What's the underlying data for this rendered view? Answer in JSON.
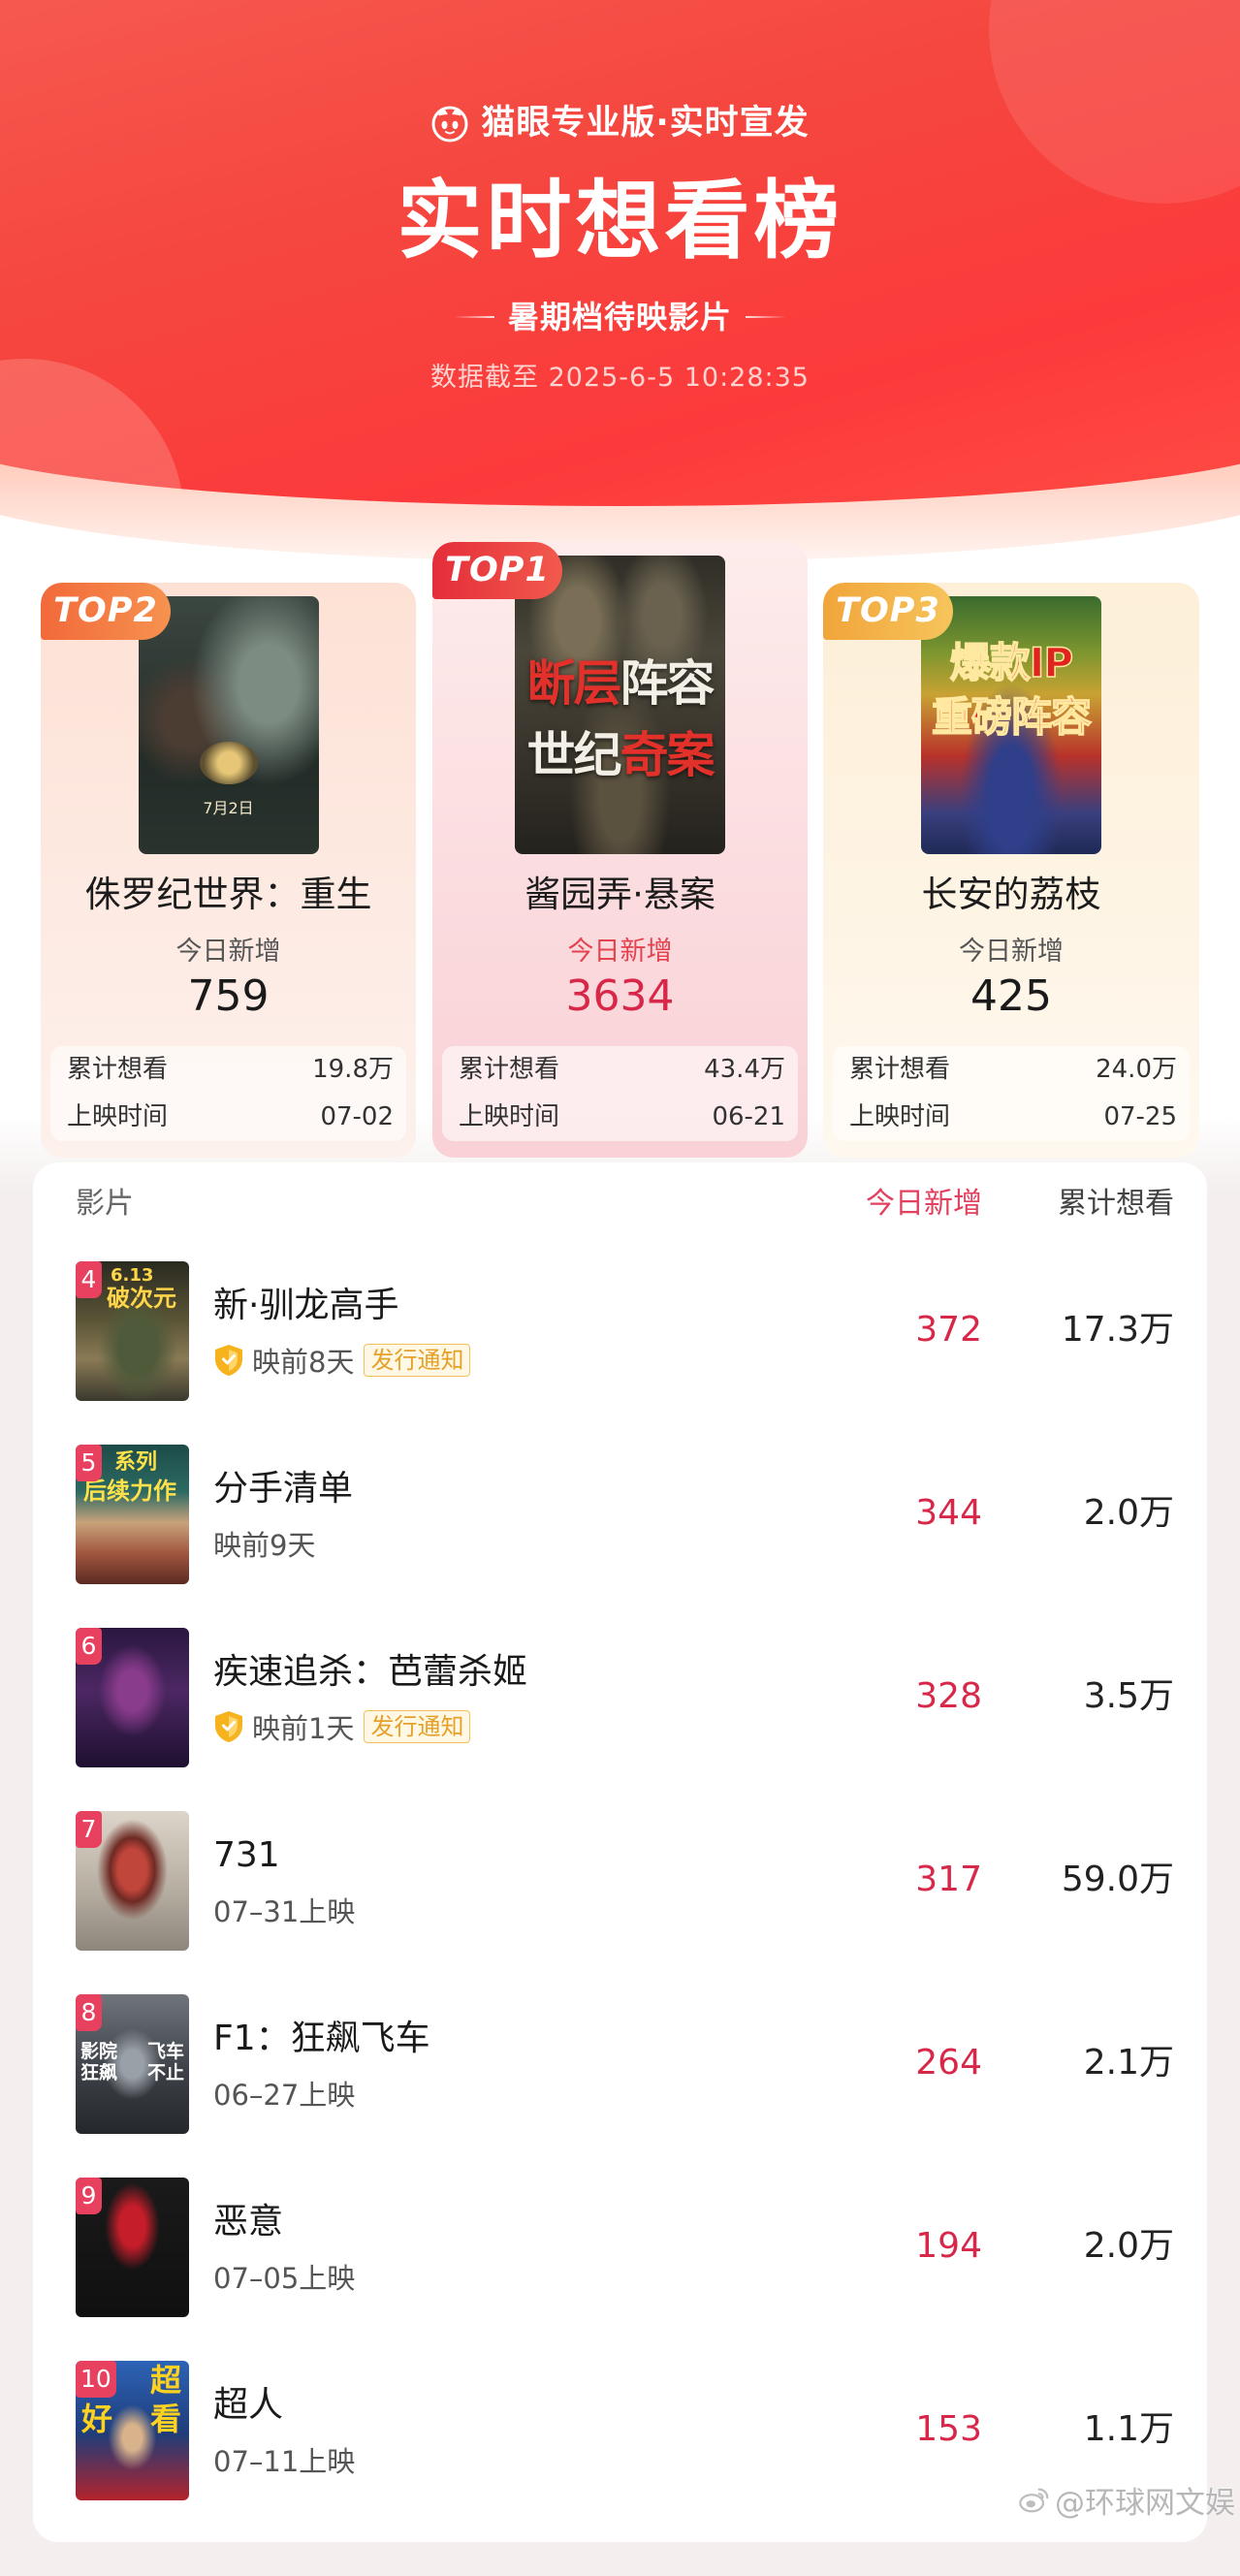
{
  "colors": {
    "brand_red": "#f5443e",
    "accent_red": "#d8284a",
    "top1_red": "#e3424f",
    "top2_orange": "#f2743a",
    "top3_gold": "#f2ac3e",
    "tag": "#e6a028"
  },
  "icons": {
    "brand": "maoyan-cat-icon",
    "status": "shield-icon",
    "watermark": "weibo-icon"
  },
  "header": {
    "brand": "猫眼专业版·实时宣发",
    "title": "实时想看榜",
    "subtitle": "暑期档待映影片",
    "timestamp": "数据截至 2025-6-5 10:28:35"
  },
  "top3": [
    {
      "badge": "TOP2",
      "title": "侏罗纪世界：重生",
      "today_label": "今日新增",
      "today": "759",
      "total_label": "累计想看",
      "total": "19.8万",
      "release_label": "上映时间",
      "release": "07-02",
      "poster": {
        "text": "7月2日"
      }
    },
    {
      "badge": "TOP1",
      "title": "酱园弄·悬案",
      "today_label": "今日新增",
      "today": "3634",
      "total_label": "累计想看",
      "total": "43.4万",
      "release_label": "上映时间",
      "release": "06-21",
      "poster": {
        "l1a": "断层",
        "l1b": "阵容",
        "l2a": "世纪",
        "l2b": "奇案"
      }
    },
    {
      "badge": "TOP3",
      "title": "长安的荔枝",
      "today_label": "今日新增",
      "today": "425",
      "total_label": "累计想看",
      "total": "24.0万",
      "release_label": "上映时间",
      "release": "07-25",
      "poster": {
        "l1": "爆款IP",
        "l2": "重磅阵容"
      }
    }
  ],
  "list": {
    "header": {
      "film": "影片",
      "today": "今日新增",
      "total": "累计想看"
    },
    "rows": [
      {
        "rank": "4",
        "title": "新·驯龙高手",
        "status": "映前8天",
        "tag": "发行通知",
        "today": "372",
        "total": "17.3万",
        "poster": {
          "a": "6.13",
          "b": "破次元"
        }
      },
      {
        "rank": "5",
        "title": "分手清单",
        "status": "映前9天",
        "today": "344",
        "total": "2.0万",
        "poster": {
          "a": "系列",
          "b": "后续力作"
        }
      },
      {
        "rank": "6",
        "title": "疾速追杀：芭蕾杀姬",
        "status": "映前1天",
        "tag": "发行通知",
        "today": "328",
        "total": "3.5万"
      },
      {
        "rank": "7",
        "title": "731",
        "status": "07–31上映",
        "today": "317",
        "total": "59.0万"
      },
      {
        "rank": "8",
        "title": "F1：狂飙飞车",
        "status": "06–27上映",
        "today": "264",
        "total": "2.1万",
        "poster": {
          "a": "影院",
          "b": "狂飙",
          "c": "飞车",
          "d": "不止"
        }
      },
      {
        "rank": "9",
        "title": "恶意",
        "status": "07–05上映",
        "today": "194",
        "total": "2.0万"
      },
      {
        "rank": "10",
        "title": "超人",
        "status": "07–11上映",
        "today": "153",
        "total": "1.1万",
        "poster": {
          "a": "超",
          "b": "好",
          "c": "看"
        }
      }
    ]
  },
  "watermark": "@环球网文娱"
}
